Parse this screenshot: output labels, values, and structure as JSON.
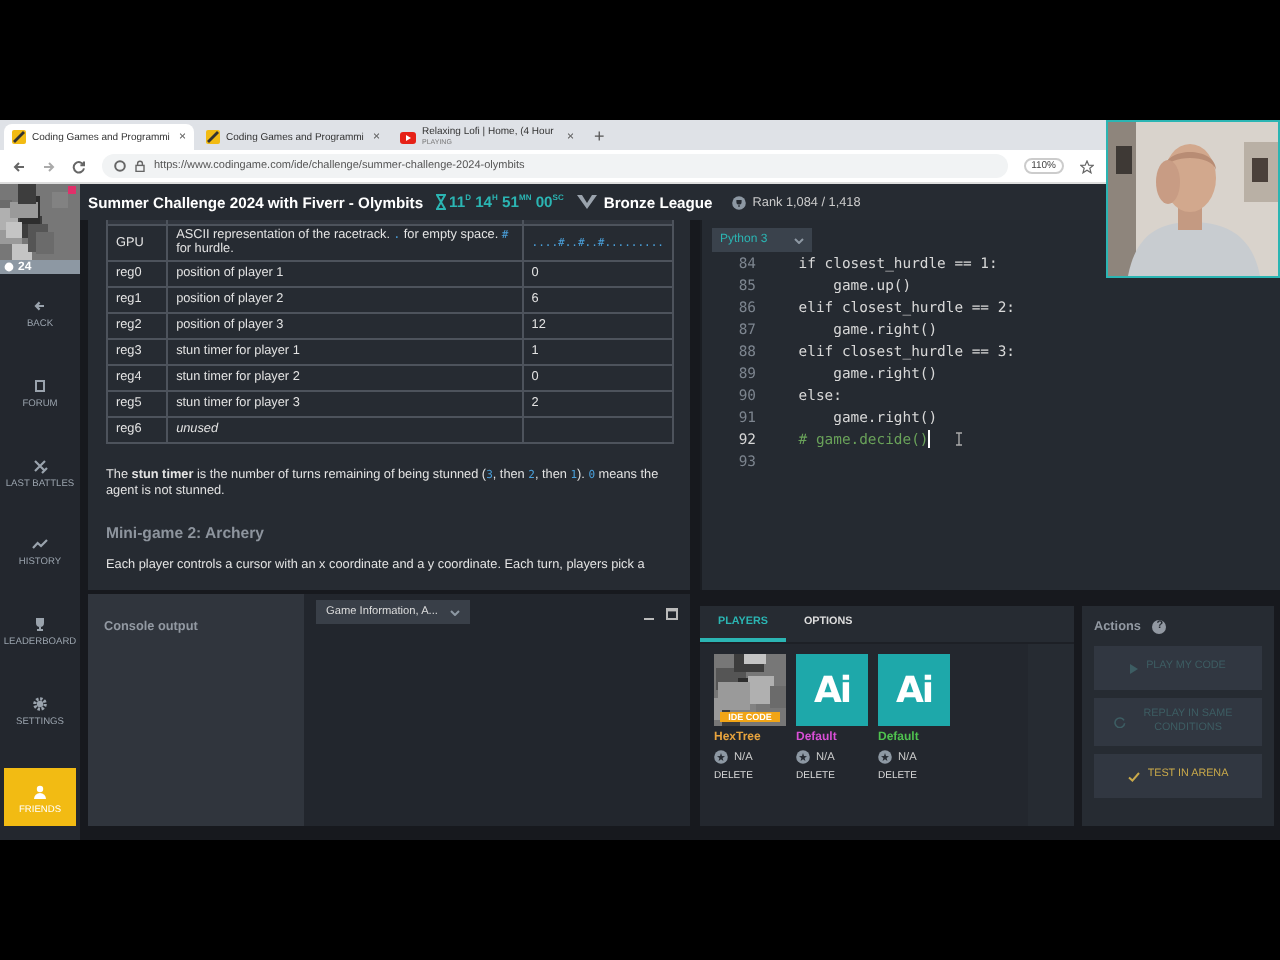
{
  "browser_tabs": [
    {
      "title": "Coding Games and Programmi",
      "close": "×",
      "selected": true,
      "kind": "site"
    },
    {
      "title": "Coding Games and Programmi",
      "close": "×",
      "selected": false,
      "kind": "site"
    },
    {
      "title": "Relaxing Lofi | Home, (4 Hour",
      "subtitle": "PLAYING",
      "close": "×",
      "selected": false,
      "kind": "video"
    }
  ],
  "new_tab": "+",
  "address_bar": {
    "url": "https://www.codingame.com/ide/challenge/summer-challenge-2024-olymbits",
    "zoom": "110%"
  },
  "sidebar": {
    "badge": "24",
    "items": [
      {
        "label": "BACK",
        "selected": false
      },
      {
        "label": "FORUM",
        "selected": false
      },
      {
        "label": "LAST BATTLES",
        "selected": false
      },
      {
        "label": "HISTORY",
        "selected": false
      },
      {
        "label": "LEADERBOARD",
        "selected": false
      },
      {
        "label": "SETTINGS",
        "selected": false
      },
      {
        "label": "FRIENDS",
        "selected": true
      }
    ]
  },
  "header": {
    "title": "Summer Challenge 2024 with Fiverr - Olymbits",
    "timer": "11$^{D}$ 14$^{H}$ 51$^{MN}$ 00$^{SC}$",
    "league": "Bronze League",
    "rank": "Rank 1,084 / 1,418"
  },
  "statement": {
    "registers": [
      {
        "register": "GPU",
        "description": [
          {
            "text": "ASCII representation of the racetrack. ",
            "kind": "plain"
          },
          {
            "text": ".",
            "kind": "code"
          },
          {
            "text": " for empty space. ",
            "kind": "plain"
          },
          {
            "text": "#",
            "kind": "code"
          },
          {
            "text": " for hurdle.",
            "kind": "plain"
          }
        ],
        "example": [
          {
            "text": "....#..#..#.........",
            "kind": "code"
          }
        ]
      },
      {
        "register": "reg0",
        "description": "position of player 1",
        "example": "0"
      },
      {
        "register": "reg1",
        "description": "position of player 2",
        "example": "6"
      },
      {
        "register": "reg2",
        "description": "position of player 3",
        "example": "12"
      },
      {
        "register": "reg3",
        "description": "stun timer for player 1",
        "example": "1"
      },
      {
        "register": "reg4",
        "description": "stun timer for player 2",
        "example": "0"
      },
      {
        "register": "reg5",
        "description": "stun timer for player 3",
        "example": "2"
      },
      {
        "register": "reg6",
        "description": [
          {
            "text": "unused",
            "kind": "italic"
          }
        ]
      }
    ],
    "paragraph": [
      {
        "text": "The ",
        "kind": "plain"
      },
      {
        "text": "stun timer",
        "kind": "bold"
      },
      {
        "text": " is the number of turns remaining of being stunned (",
        "kind": "plain"
      },
      {
        "text": "3",
        "kind": "code"
      },
      {
        "text": ", then ",
        "kind": "plain"
      },
      {
        "text": "2",
        "kind": "code"
      },
      {
        "text": ", then ",
        "kind": "plain"
      },
      {
        "text": "1",
        "kind": "code"
      },
      {
        "text": "). ",
        "kind": "plain"
      },
      {
        "text": "0",
        "kind": "code"
      },
      {
        "text": " means the agent is not stunned.",
        "kind": "plain"
      }
    ],
    "heading": "Mini-game 2: Archery",
    "text": "Each player controls a cursor with an x coordinate and a y coordinate. Each turn, players pick a"
  },
  "editor": {
    "language": "Python 3",
    "lines": [
      {
        "number": "84",
        "code": "    if closest_hurdle == 1:",
        "kind": "code",
        "current": false
      },
      {
        "number": "85",
        "code": "        game.up()",
        "kind": "code",
        "current": false
      },
      {
        "number": "86",
        "code": "    elif closest_hurdle == 2:",
        "kind": "code",
        "current": false
      },
      {
        "number": "87",
        "code": "        game.right()",
        "kind": "code",
        "current": false
      },
      {
        "number": "88",
        "code": "    elif closest_hurdle == 3:",
        "kind": "code",
        "current": false
      },
      {
        "number": "89",
        "code": "        game.right()",
        "kind": "code",
        "current": false
      },
      {
        "number": "90",
        "code": "    else:",
        "kind": "code",
        "current": false
      },
      {
        "number": "91",
        "code": "        game.right()",
        "kind": "code",
        "current": false
      },
      {
        "number": "92",
        "code": "    # game.decide()",
        "kind": "comment",
        "current": true
      },
      {
        "number": "93",
        "kind": "code",
        "current": false
      }
    ]
  },
  "console": {
    "title": "Console output",
    "filter": "Game Information, A..."
  },
  "players": {
    "tabs": [
      {
        "label": "PLAYERS",
        "selected": true
      },
      {
        "label": "OPTIONS",
        "selected": false
      }
    ],
    "list": [
      {
        "name": "HexTree",
        "color": "#e8a33d",
        "kind": "picture",
        "badge": "IDE CODE",
        "rating": "N/A",
        "action": "DELETE"
      },
      {
        "name": "Default",
        "color": "#d94fd6",
        "kind": "ai",
        "avatar_text": "Ai",
        "rating": "N/A",
        "action": "DELETE"
      },
      {
        "name": "Default",
        "color": "#4fc24f",
        "kind": "ai",
        "avatar_text": "Ai",
        "rating": "N/A",
        "action": "DELETE"
      }
    ]
  },
  "actions": {
    "title": "Actions",
    "help": "?",
    "buttons": [
      {
        "label": "PLAY MY CODE",
        "kind": "play",
        "disabled": true
      },
      {
        "label": "REPLAY IN SAME CONDITIONS",
        "kind": "replay",
        "disabled": true
      },
      {
        "label": "TEST IN ARENA",
        "kind": "arena",
        "disabled": false
      }
    ]
  }
}
